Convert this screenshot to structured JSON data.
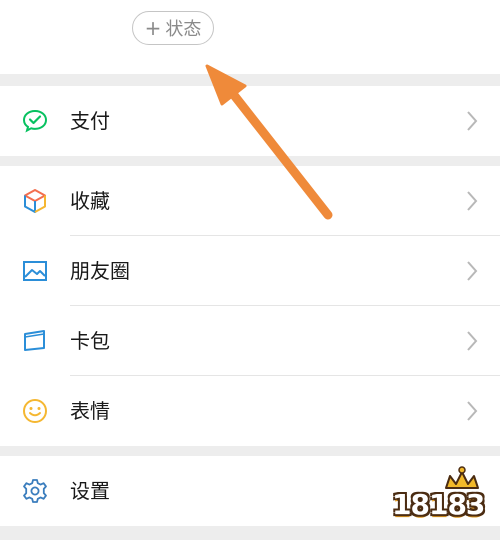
{
  "header": {
    "status_plus": "+",
    "status_label": "状态"
  },
  "menu_groups": [
    {
      "items": [
        {
          "label": "支付",
          "icon": "wechat-pay-icon",
          "icon_color": "#07c160"
        }
      ]
    },
    {
      "items": [
        {
          "label": "收藏",
          "icon": "favorites-cube-icon",
          "icon_color": "#f5a623"
        },
        {
          "label": "朋友圈",
          "icon": "moments-picture-icon",
          "icon_color": "#2b8ed8"
        },
        {
          "label": "卡包",
          "icon": "card-wallet-icon",
          "icon_color": "#2b8ed8"
        },
        {
          "label": "表情",
          "icon": "emoji-smile-icon",
          "icon_color": "#f5b731"
        }
      ]
    },
    {
      "items": [
        {
          "label": "设置",
          "icon": "settings-gear-icon",
          "icon_color": "#3a7dbd"
        }
      ]
    }
  ],
  "annotation": {
    "arrow_color": "#ef8a3a",
    "points_to": "status-button"
  },
  "watermark": {
    "text": "18183"
  }
}
